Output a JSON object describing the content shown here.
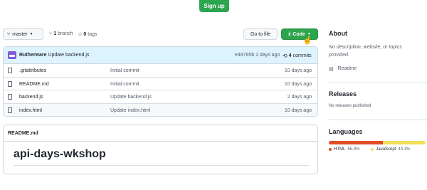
{
  "header": {
    "signup_label": "Sign up"
  },
  "toolbar": {
    "branch": "master",
    "branches_count": "1",
    "branches_label": "branch",
    "tags_count": "0",
    "tags_label": "tags",
    "goto_label": "Go to file",
    "code_label": "Code"
  },
  "commit": {
    "author": "Rutherware",
    "message": "Update backend.js",
    "hash": "e48785b",
    "when": "2 days ago",
    "count": "4",
    "count_label": "commits"
  },
  "files": [
    {
      "name": ".gitattributes",
      "commit": "Initial commit",
      "date": "10 days ago"
    },
    {
      "name": "README.md",
      "commit": "Initial commit",
      "date": "10 days ago"
    },
    {
      "name": "backend.js",
      "commit": "Update backend.js",
      "date": "2 days ago"
    },
    {
      "name": "index.html",
      "commit": "Update index.html",
      "date": "10 days ago"
    }
  ],
  "readme": {
    "filename": "README.md",
    "title": "api-days-wkshop"
  },
  "sidebar": {
    "about_title": "About",
    "about_desc": "No description, website, or topics provided.",
    "readme_link": "Readme",
    "releases_title": "Releases",
    "releases_desc": "No releases published",
    "languages_title": "Languages",
    "languages": [
      {
        "name": "HTML",
        "percent": "55.9%",
        "color": "#e34c26",
        "share": 55.9
      },
      {
        "name": "JavaScript",
        "percent": "44.1%",
        "color": "#f1e05a",
        "share": 44.1
      }
    ]
  }
}
